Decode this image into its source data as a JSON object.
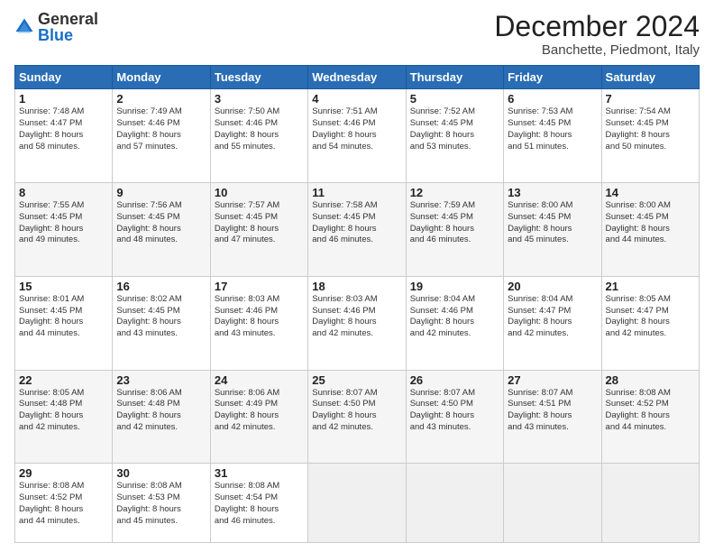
{
  "logo": {
    "general": "General",
    "blue": "Blue"
  },
  "header": {
    "month": "December 2024",
    "location": "Banchette, Piedmont, Italy"
  },
  "weekdays": [
    "Sunday",
    "Monday",
    "Tuesday",
    "Wednesday",
    "Thursday",
    "Friday",
    "Saturday"
  ],
  "weeks": [
    [
      {
        "day": 1,
        "lines": [
          "Sunrise: 7:48 AM",
          "Sunset: 4:47 PM",
          "Daylight: 8 hours",
          "and 58 minutes."
        ]
      },
      {
        "day": 2,
        "lines": [
          "Sunrise: 7:49 AM",
          "Sunset: 4:46 PM",
          "Daylight: 8 hours",
          "and 57 minutes."
        ]
      },
      {
        "day": 3,
        "lines": [
          "Sunrise: 7:50 AM",
          "Sunset: 4:46 PM",
          "Daylight: 8 hours",
          "and 55 minutes."
        ]
      },
      {
        "day": 4,
        "lines": [
          "Sunrise: 7:51 AM",
          "Sunset: 4:46 PM",
          "Daylight: 8 hours",
          "and 54 minutes."
        ]
      },
      {
        "day": 5,
        "lines": [
          "Sunrise: 7:52 AM",
          "Sunset: 4:45 PM",
          "Daylight: 8 hours",
          "and 53 minutes."
        ]
      },
      {
        "day": 6,
        "lines": [
          "Sunrise: 7:53 AM",
          "Sunset: 4:45 PM",
          "Daylight: 8 hours",
          "and 51 minutes."
        ]
      },
      {
        "day": 7,
        "lines": [
          "Sunrise: 7:54 AM",
          "Sunset: 4:45 PM",
          "Daylight: 8 hours",
          "and 50 minutes."
        ]
      }
    ],
    [
      {
        "day": 8,
        "lines": [
          "Sunrise: 7:55 AM",
          "Sunset: 4:45 PM",
          "Daylight: 8 hours",
          "and 49 minutes."
        ]
      },
      {
        "day": 9,
        "lines": [
          "Sunrise: 7:56 AM",
          "Sunset: 4:45 PM",
          "Daylight: 8 hours",
          "and 48 minutes."
        ]
      },
      {
        "day": 10,
        "lines": [
          "Sunrise: 7:57 AM",
          "Sunset: 4:45 PM",
          "Daylight: 8 hours",
          "and 47 minutes."
        ]
      },
      {
        "day": 11,
        "lines": [
          "Sunrise: 7:58 AM",
          "Sunset: 4:45 PM",
          "Daylight: 8 hours",
          "and 46 minutes."
        ]
      },
      {
        "day": 12,
        "lines": [
          "Sunrise: 7:59 AM",
          "Sunset: 4:45 PM",
          "Daylight: 8 hours",
          "and 46 minutes."
        ]
      },
      {
        "day": 13,
        "lines": [
          "Sunrise: 8:00 AM",
          "Sunset: 4:45 PM",
          "Daylight: 8 hours",
          "and 45 minutes."
        ]
      },
      {
        "day": 14,
        "lines": [
          "Sunrise: 8:00 AM",
          "Sunset: 4:45 PM",
          "Daylight: 8 hours",
          "and 44 minutes."
        ]
      }
    ],
    [
      {
        "day": 15,
        "lines": [
          "Sunrise: 8:01 AM",
          "Sunset: 4:45 PM",
          "Daylight: 8 hours",
          "and 44 minutes."
        ]
      },
      {
        "day": 16,
        "lines": [
          "Sunrise: 8:02 AM",
          "Sunset: 4:45 PM",
          "Daylight: 8 hours",
          "and 43 minutes."
        ]
      },
      {
        "day": 17,
        "lines": [
          "Sunrise: 8:03 AM",
          "Sunset: 4:46 PM",
          "Daylight: 8 hours",
          "and 43 minutes."
        ]
      },
      {
        "day": 18,
        "lines": [
          "Sunrise: 8:03 AM",
          "Sunset: 4:46 PM",
          "Daylight: 8 hours",
          "and 42 minutes."
        ]
      },
      {
        "day": 19,
        "lines": [
          "Sunrise: 8:04 AM",
          "Sunset: 4:46 PM",
          "Daylight: 8 hours",
          "and 42 minutes."
        ]
      },
      {
        "day": 20,
        "lines": [
          "Sunrise: 8:04 AM",
          "Sunset: 4:47 PM",
          "Daylight: 8 hours",
          "and 42 minutes."
        ]
      },
      {
        "day": 21,
        "lines": [
          "Sunrise: 8:05 AM",
          "Sunset: 4:47 PM",
          "Daylight: 8 hours",
          "and 42 minutes."
        ]
      }
    ],
    [
      {
        "day": 22,
        "lines": [
          "Sunrise: 8:05 AM",
          "Sunset: 4:48 PM",
          "Daylight: 8 hours",
          "and 42 minutes."
        ]
      },
      {
        "day": 23,
        "lines": [
          "Sunrise: 8:06 AM",
          "Sunset: 4:48 PM",
          "Daylight: 8 hours",
          "and 42 minutes."
        ]
      },
      {
        "day": 24,
        "lines": [
          "Sunrise: 8:06 AM",
          "Sunset: 4:49 PM",
          "Daylight: 8 hours",
          "and 42 minutes."
        ]
      },
      {
        "day": 25,
        "lines": [
          "Sunrise: 8:07 AM",
          "Sunset: 4:50 PM",
          "Daylight: 8 hours",
          "and 42 minutes."
        ]
      },
      {
        "day": 26,
        "lines": [
          "Sunrise: 8:07 AM",
          "Sunset: 4:50 PM",
          "Daylight: 8 hours",
          "and 43 minutes."
        ]
      },
      {
        "day": 27,
        "lines": [
          "Sunrise: 8:07 AM",
          "Sunset: 4:51 PM",
          "Daylight: 8 hours",
          "and 43 minutes."
        ]
      },
      {
        "day": 28,
        "lines": [
          "Sunrise: 8:08 AM",
          "Sunset: 4:52 PM",
          "Daylight: 8 hours",
          "and 44 minutes."
        ]
      }
    ],
    [
      {
        "day": 29,
        "lines": [
          "Sunrise: 8:08 AM",
          "Sunset: 4:52 PM",
          "Daylight: 8 hours",
          "and 44 minutes."
        ]
      },
      {
        "day": 30,
        "lines": [
          "Sunrise: 8:08 AM",
          "Sunset: 4:53 PM",
          "Daylight: 8 hours",
          "and 45 minutes."
        ]
      },
      {
        "day": 31,
        "lines": [
          "Sunrise: 8:08 AM",
          "Sunset: 4:54 PM",
          "Daylight: 8 hours",
          "and 46 minutes."
        ]
      },
      null,
      null,
      null,
      null
    ]
  ]
}
